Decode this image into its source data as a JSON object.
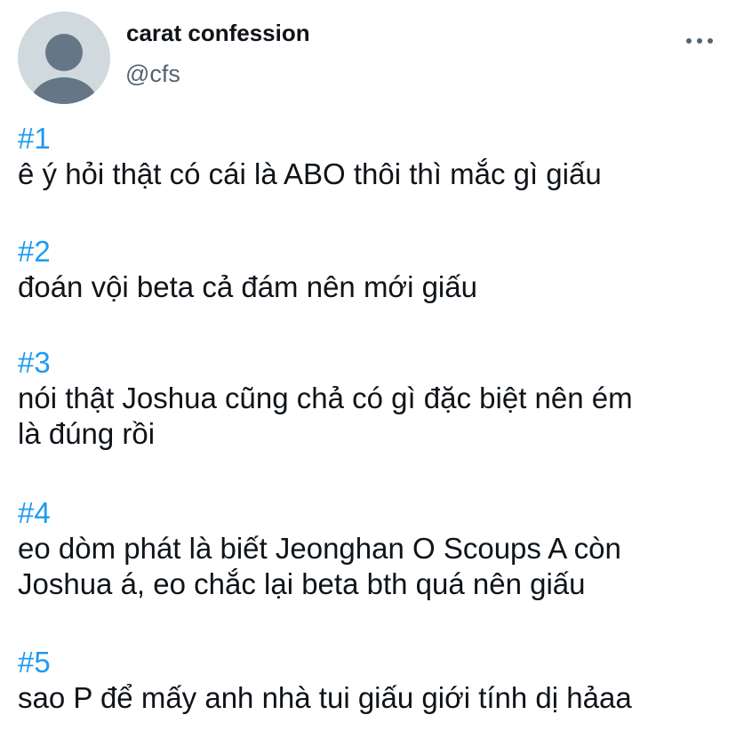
{
  "author": {
    "display_name": "carat confession",
    "handle": "@cfs",
    "avatar_icon": "default-profile-avatar"
  },
  "menu_icon": "more-horizontal-icon",
  "colors": {
    "hashtag": "#1d9bf0",
    "text": "#0f1419",
    "secondary": "#536471",
    "avatar_bg": "#cfd9de",
    "avatar_fg": "#657786"
  },
  "posts": [
    {
      "num": "#1",
      "lines": [
        "ê ý hỏi thật có cái là ABO thôi thì mắc gì giấu"
      ]
    },
    {
      "num": "#2",
      "lines": [
        "đoán vội beta cả đám nên mới giấu"
      ]
    },
    {
      "num": "#3",
      "lines": [
        "nói thật Joshua cũng chả có gì đặc biệt nên ém",
        "là đúng rồi"
      ]
    },
    {
      "num": "#4",
      "lines": [
        "eo dòm phát là biết Jeonghan O Scoups A còn",
        "Joshua á, eo chắc lại beta bth quá nên giấu"
      ]
    },
    {
      "num": "#5",
      "lines": [
        "sao P để mấy anh nhà tui giấu giới tính dị hảaa"
      ]
    }
  ]
}
